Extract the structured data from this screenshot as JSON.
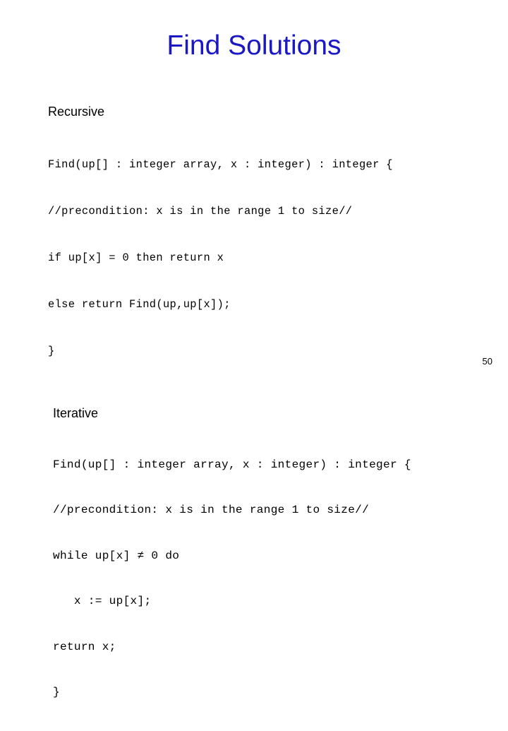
{
  "slide": {
    "title": "Find Solutions",
    "title_color": "#1a17c4",
    "background_color": "#ffffff",
    "page_number": "50"
  },
  "sections": [
    {
      "heading": "Recursive",
      "code_lines": [
        "Find(up[] : integer array, x : integer) : integer {",
        "//precondition: x is in the range 1 to size//",
        "if up[x] = 0 then return x",
        "else return Find(up,up[x]);",
        "}"
      ]
    },
    {
      "heading": "Iterative",
      "code_lines": [
        "Find(up[] : integer array, x : integer) : integer {",
        "//precondition: x is in the range 1 to size//",
        "while up[x] ≠ 0 do",
        "   x := up[x];",
        "return x;",
        "}"
      ]
    }
  ]
}
